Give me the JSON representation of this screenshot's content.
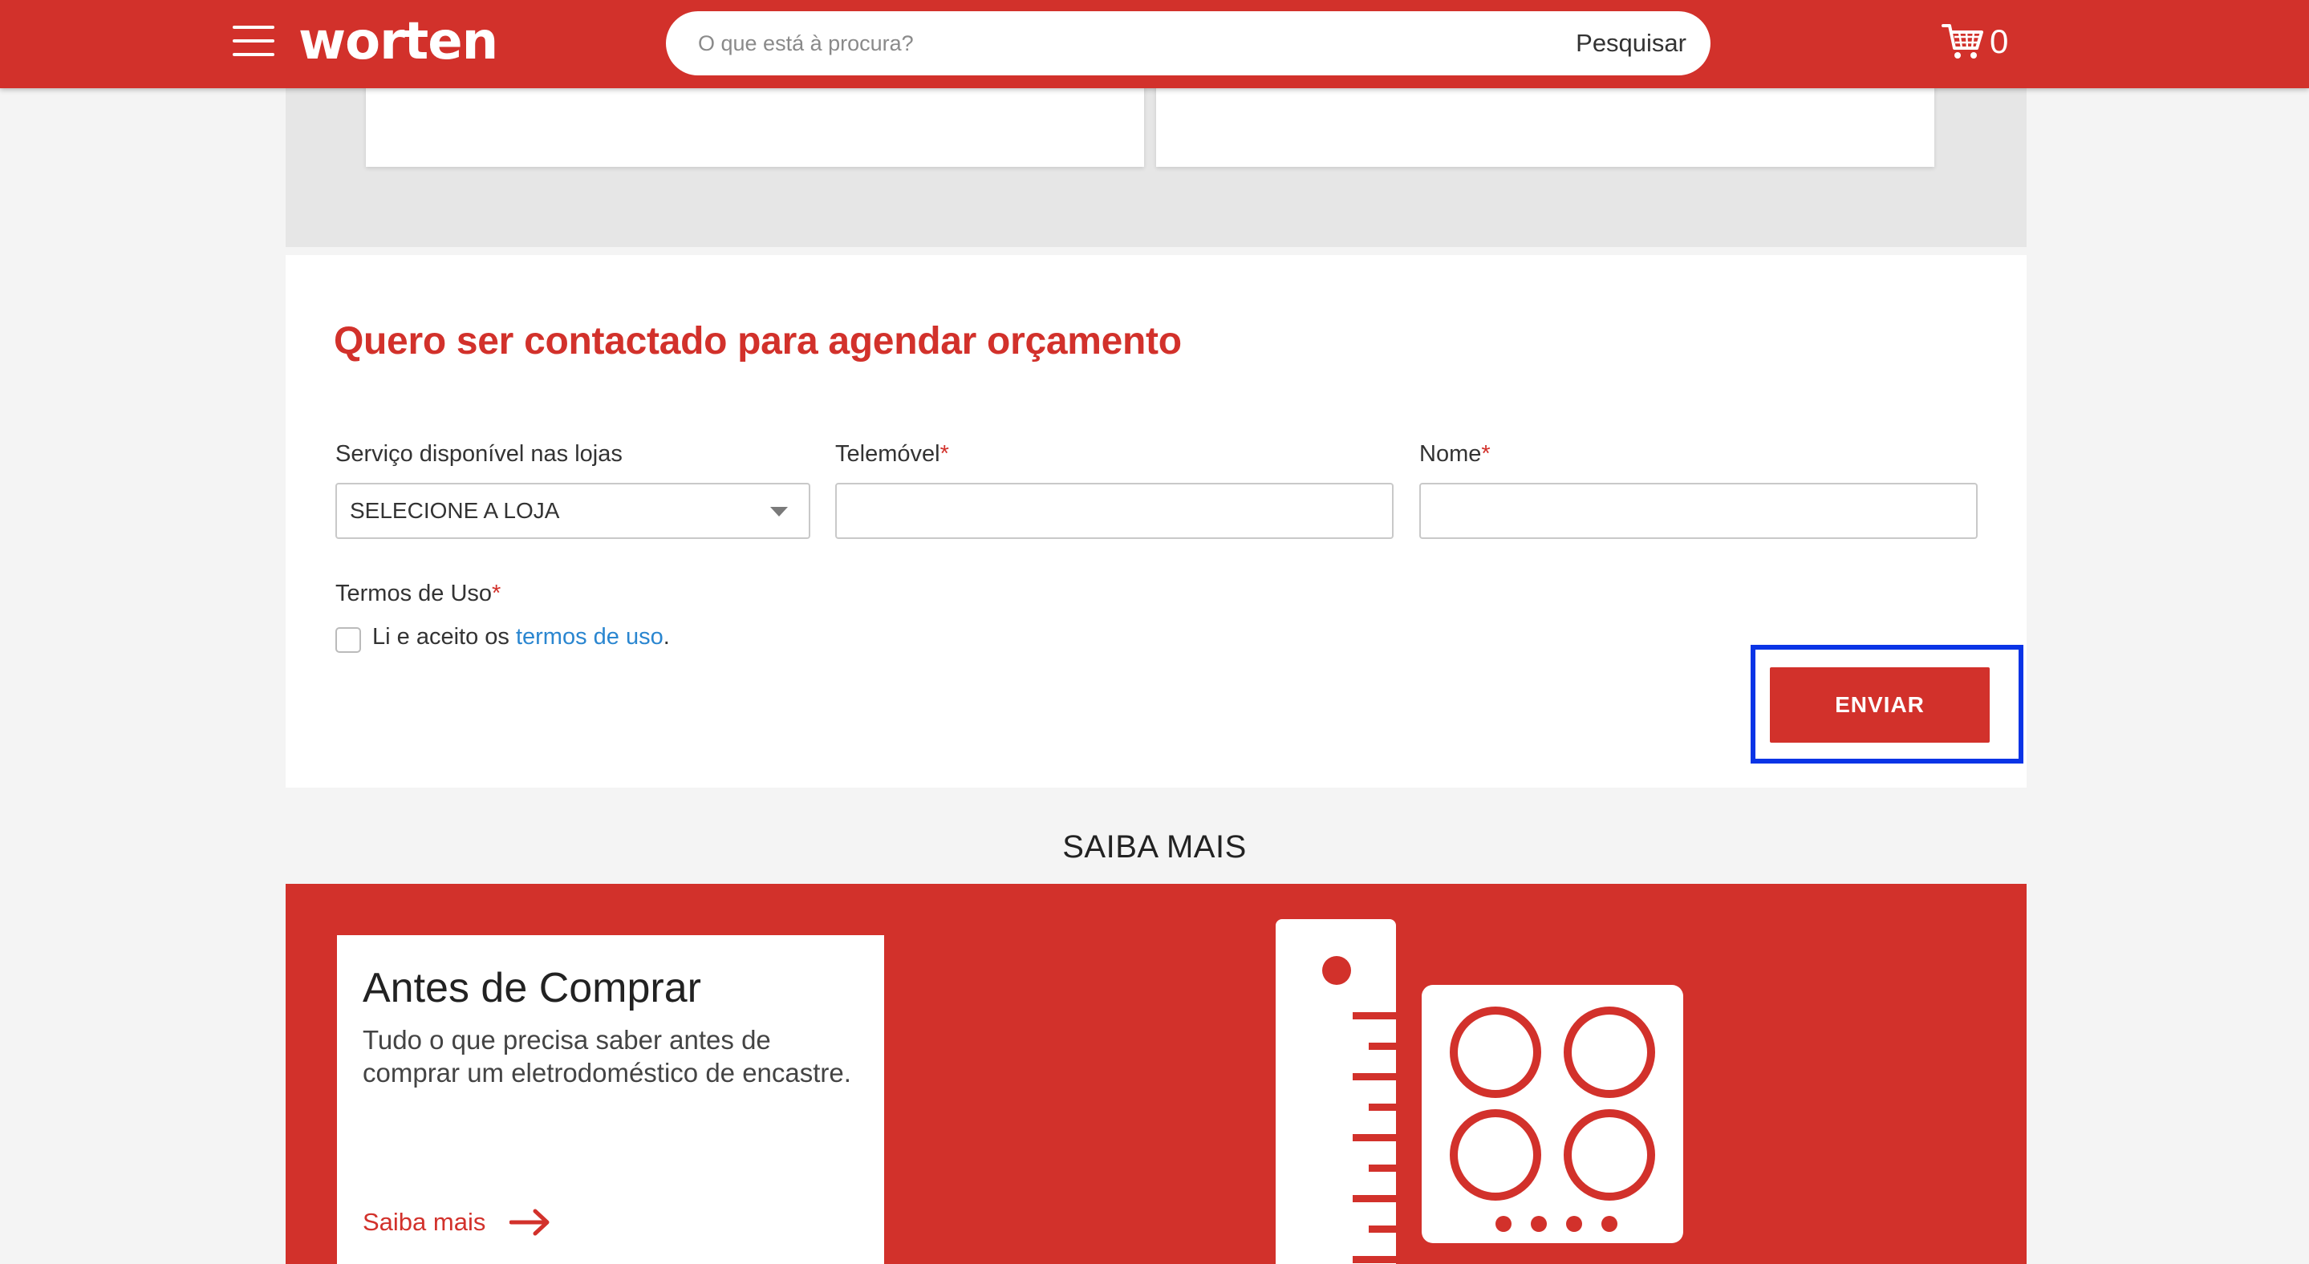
{
  "header": {
    "logo": "worten",
    "search_placeholder": "O que está à procura?",
    "search_button": "Pesquisar",
    "cart_count": "0",
    "menu_icon": "hamburger-menu-icon",
    "cart_icon": "shopping-cart-icon"
  },
  "form": {
    "title": "Quero ser contactado para agendar orçamento",
    "store_label": "Serviço disponível nas lojas",
    "store_select_value": "SELECIONE A LOJA",
    "phone_label": "Telemóvel",
    "phone_value": "",
    "name_label": "Nome",
    "name_value": "",
    "required_mark": "*",
    "terms_label": "Termos de Uso",
    "terms_text": "Li e aceito os",
    "terms_link": "termos de uso",
    "terms_period": ".",
    "submit_label": "ENVIAR"
  },
  "saiba_mais": {
    "title": "SAIBA MAIS",
    "card_title": "Antes de Comprar",
    "card_text": "Tudo o que precisa saber antes de comprar um eletrodoméstico de encastre.",
    "card_link": "Saiba mais"
  },
  "colors": {
    "brand_red": "#d2312b",
    "link_blue": "#2a86d0",
    "highlight_blue": "#0a34e6"
  }
}
